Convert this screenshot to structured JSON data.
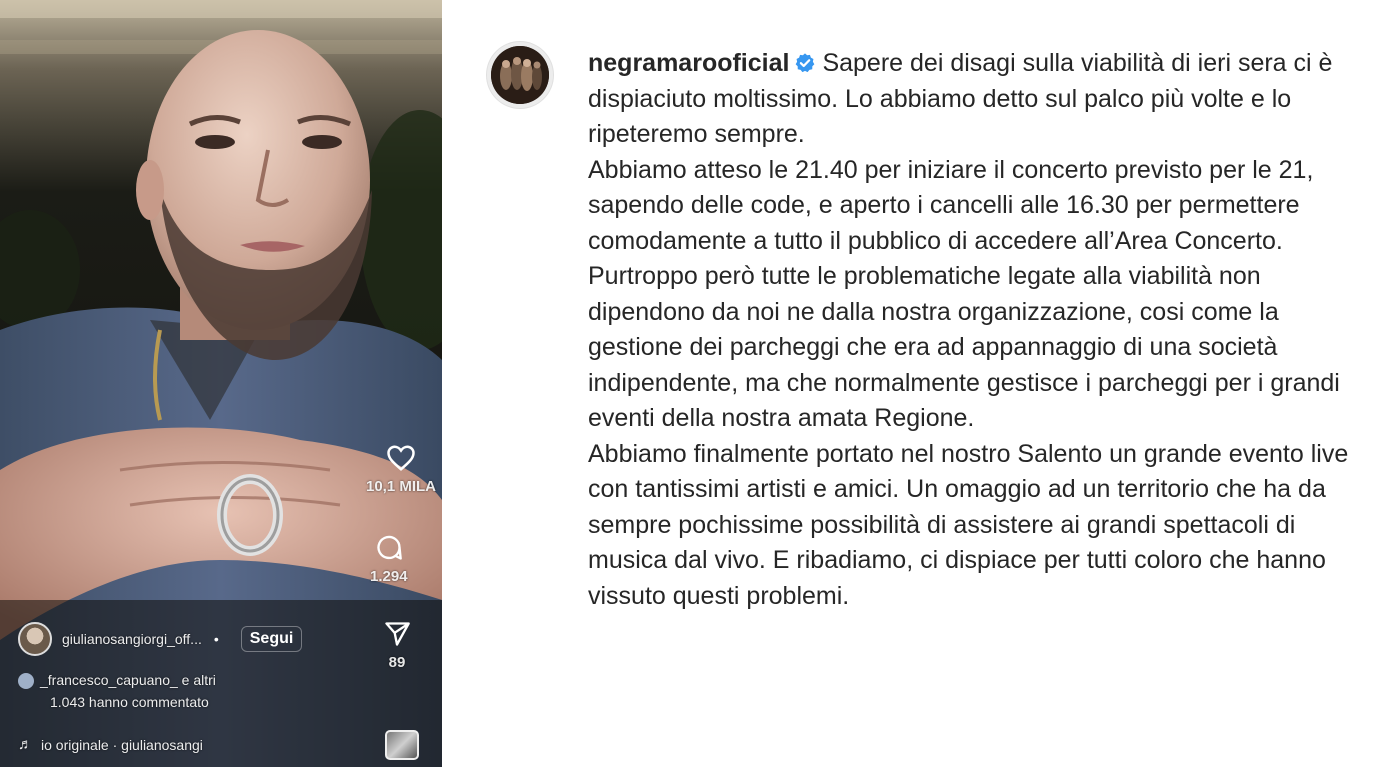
{
  "reel": {
    "likes_count": "10,1 MILA",
    "comments_count": "1.294",
    "shares_count": "89",
    "author_username": "giulianosangiorgi_off...",
    "follow_label": "Segui",
    "commenters_text": "_francesco_capuano_ e altri",
    "commented_text": "1.043 hanno commentato",
    "audio_text": "io originale · giulianosangi",
    "icons": [
      "heart-icon",
      "comment-icon",
      "share-icon",
      "music-note-icon"
    ]
  },
  "post": {
    "username": "negramarooficial",
    "verified": true,
    "accent_color": "#3797f0",
    "caption_first_line": "Sapere dei disagi sulla viabilità di ieri sera ci è dispiaciuto moltissimo. Lo abbiamo detto sul palco più volte e lo ripeteremo sempre.",
    "caption_paragraphs": [
      "Abbiamo atteso le 21.40 per iniziare il concerto previsto per le 21, sapendo delle code, e aperto i cancelli alle 16.30 per permettere comodamente a tutto il pubblico di accedere all’Area Concerto.",
      "Purtroppo però tutte le problematiche legate alla viabilità non dipendono da noi ne dalla nostra organizzazione, cosi come la gestione dei parcheggi che era ad appannaggio di una società indipendente, ma che normalmente gestisce i parcheggi per i grandi eventi della nostra amata Regione.",
      "Abbiamo finalmente portato nel nostro Salento un grande evento live con tantissimi artisti e amici. Un omaggio ad un territorio che ha da sempre pochissime possibilità di assistere ai grandi spettacoli di musica dal vivo. E ribadiamo, ci dispiace per tutti coloro che hanno vissuto questi problemi."
    ]
  }
}
